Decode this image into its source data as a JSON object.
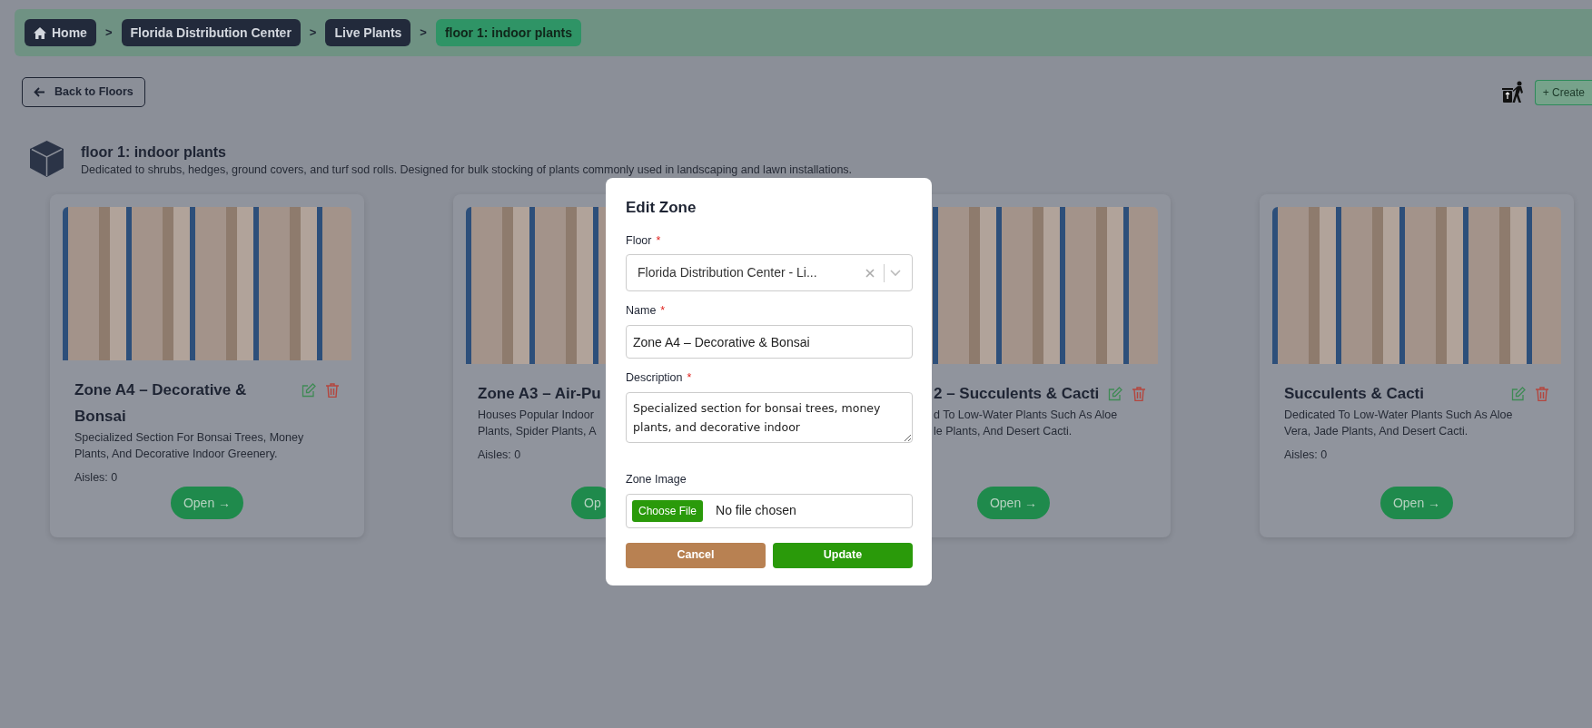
{
  "breadcrumb": [
    {
      "label": "Home",
      "selected": false,
      "separator_after": ">"
    },
    {
      "label": "Florida Distribution Center",
      "selected": false,
      "separator_after": ">"
    },
    {
      "label": "Live Plants",
      "selected": false,
      "separator_after": ">"
    },
    {
      "label": "floor 1: indoor plants",
      "selected": true
    }
  ],
  "toolbar": {
    "back_button": "Back to Floors",
    "create_button": "+ Create"
  },
  "floor": {
    "title": "floor 1: indoor plants",
    "description": "Dedicated to shrubs, hedges, ground covers, and turf sod rolls. Designed for bulk stocking of plants commonly used in landscaping and lawn installations."
  },
  "zones": [
    {
      "kind": "full",
      "title": "Zone A4 – Decorative & Bonsai",
      "actions": true,
      "description_lines": [
        "Specialized Section For Bonsai Trees, Money",
        "Plants, And Decorative Indoor Greenery."
      ],
      "aisles": "Aisles: 0",
      "open_button": "Open →"
    },
    {
      "kind": "cut-right",
      "title": "Zone A3 – Air-Pu",
      "description_lines": [
        "Houses Popular Indoor",
        "Plants, Spider Plants, A"
      ],
      "aisles": "Aisles: 0",
      "open_button": "Op"
    },
    {
      "kind": "cut-left",
      "title": "2 – Succulents & Cacti",
      "actions": true,
      "description_lines": [
        "d To Low-Water Plants Such As Aloe",
        "le Plants, And Desert Cacti."
      ],
      "open_button": "Open →"
    },
    {
      "kind": "full",
      "title": "Succulents & Cacti",
      "actions": true,
      "description_lines": [
        "Dedicated To Low-Water Plants Such As Aloe",
        "Vera, Jade Plants, And Desert Cacti."
      ],
      "aisles": "Aisles: 0",
      "open_button": "Open →"
    }
  ],
  "modal": {
    "title": "Edit Zone",
    "fields": [
      {
        "kind": "select",
        "label": "Floor",
        "required_mark": "*",
        "value": "Florida Distribution Center - Li..."
      },
      {
        "kind": "text",
        "label": "Name",
        "required_mark": "*",
        "value": "Zone A4 – Decorative & Bonsai"
      },
      {
        "kind": "textarea",
        "label": "Description",
        "required_mark": "*",
        "value": "Specialized section for bonsai trees, money plants, and decorative indoor"
      },
      {
        "kind": "file",
        "label": "Zone Image",
        "button": "Choose File",
        "status": "No file chosen"
      }
    ],
    "buttons": [
      {
        "kind": "cancel",
        "label": "Cancel"
      },
      {
        "kind": "submit",
        "label": "Update"
      }
    ]
  }
}
